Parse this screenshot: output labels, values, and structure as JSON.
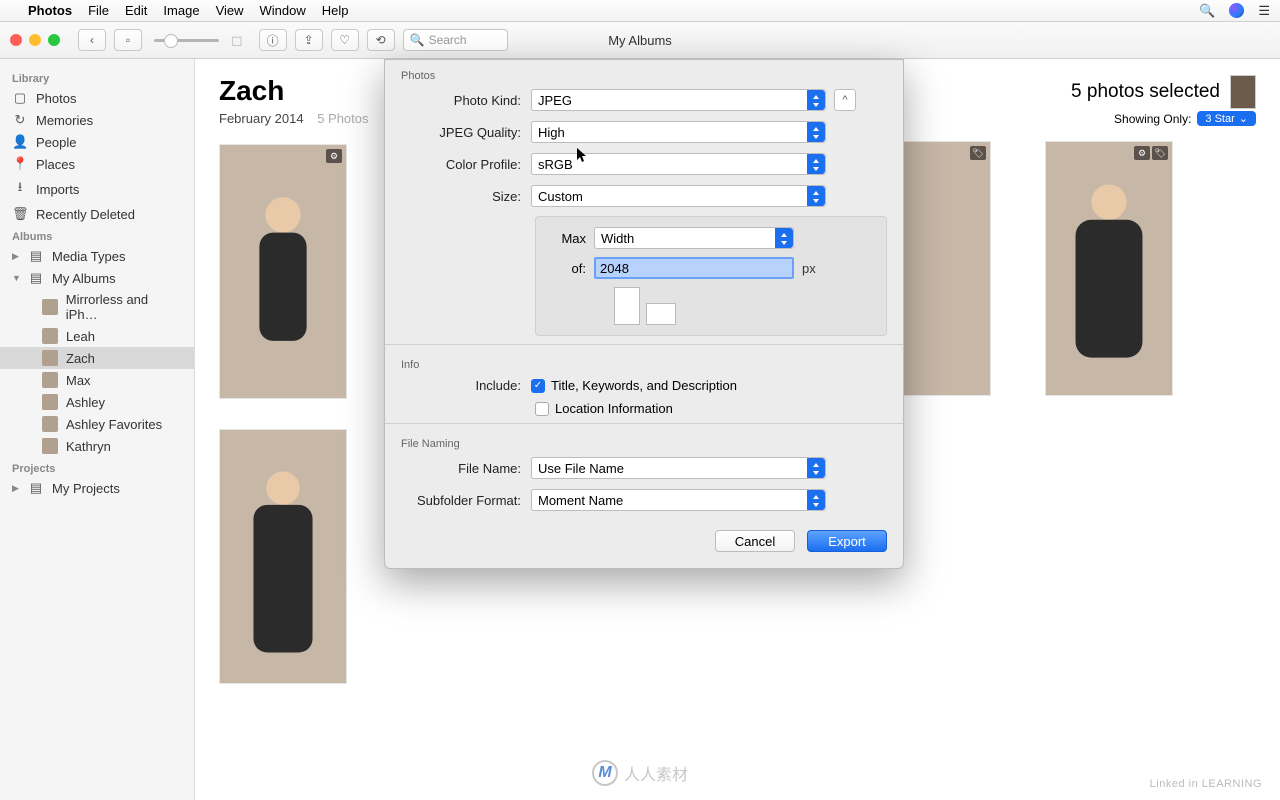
{
  "menubar": {
    "app": "Photos",
    "items": [
      "File",
      "Edit",
      "Image",
      "View",
      "Window",
      "Help"
    ]
  },
  "toolbar": {
    "title": "My Albums",
    "back_icon": "‹",
    "search_placeholder": "Search"
  },
  "sidebar": {
    "library_head": "Library",
    "library": [
      {
        "icon": "▢",
        "label": "Photos"
      },
      {
        "icon": "↻",
        "label": "Memories"
      },
      {
        "icon": "👤",
        "label": "People"
      },
      {
        "icon": "📍",
        "label": "Places"
      },
      {
        "icon": "⭳",
        "label": "Imports"
      },
      {
        "icon": "🗑",
        "label": "Recently Deleted"
      }
    ],
    "albums_head": "Albums",
    "media_types": "Media Types",
    "my_albums": "My Albums",
    "albums": [
      {
        "label": "Mirrorless and iPh…"
      },
      {
        "label": "Leah"
      },
      {
        "label": "Zach",
        "selected": true
      },
      {
        "label": "Max"
      },
      {
        "label": "Ashley"
      },
      {
        "label": "Ashley Favorites"
      },
      {
        "label": "Kathryn"
      }
    ],
    "projects_head": "Projects",
    "my_projects": "My Projects"
  },
  "content": {
    "title": "Zach",
    "date": "February 2014",
    "count": "5 Photos",
    "selected": "5 photos selected",
    "showing": "Showing Only:",
    "star_filter": "3 Star"
  },
  "dialog": {
    "section_photos": "Photos",
    "photo_kind_label": "Photo Kind:",
    "photo_kind": "JPEG",
    "jpeg_quality_label": "JPEG Quality:",
    "jpeg_quality": "High",
    "color_profile_label": "Color Profile:",
    "color_profile": "sRGB",
    "size_label": "Size:",
    "size": "Custom",
    "max_label": "Max",
    "max_dimension": "Width",
    "of_label": "of:",
    "of_value": "2048",
    "px": "px",
    "section_info": "Info",
    "include_label": "Include:",
    "include_title": "Title, Keywords, and Description",
    "include_location": "Location Information",
    "section_file_naming": "File Naming",
    "file_name_label": "File Name:",
    "file_name": "Use File Name",
    "subfolder_label": "Subfolder Format:",
    "subfolder": "Moment Name",
    "cancel": "Cancel",
    "export": "Export"
  },
  "footer": {
    "center": "人人素材",
    "right": "Linked in LEARNING"
  }
}
